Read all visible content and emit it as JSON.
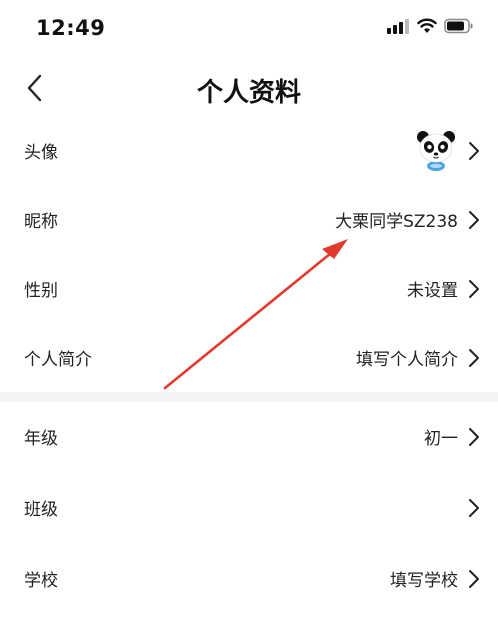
{
  "status_bar": {
    "time": "12:49"
  },
  "header": {
    "title": "个人资料"
  },
  "profile": {
    "rows": [
      {
        "label": "头像",
        "value": ""
      },
      {
        "label": "昵称",
        "value": "大栗同学SZ238"
      },
      {
        "label": "性别",
        "value": "未设置"
      },
      {
        "label": "个人简介",
        "value": "填写个人简介"
      }
    ]
  },
  "school": {
    "rows": [
      {
        "label": "年级",
        "value": "初一"
      },
      {
        "label": "班级",
        "value": ""
      },
      {
        "label": "学校",
        "value": "填写学校"
      }
    ]
  },
  "colors": {
    "annotation_arrow": "#e03a2f",
    "section_gap": "#f4f4f6"
  },
  "icons": {
    "avatar": "panda-avatar-icon",
    "back": "chevron-left-icon",
    "row_arrow": "chevron-right-icon"
  }
}
